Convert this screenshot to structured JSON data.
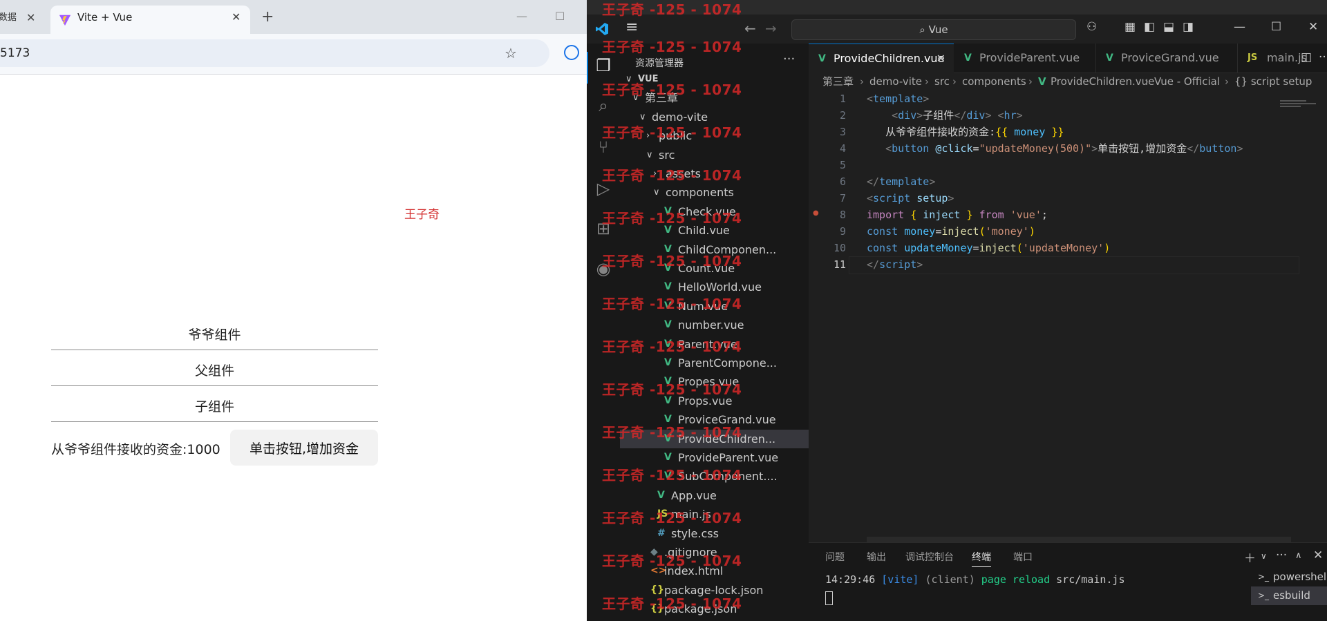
{
  "browser": {
    "prev_tab_title": "数据",
    "tab_title": "Vite + Vue",
    "url": "5173",
    "page": {
      "name": "王子奇",
      "grandparent_label": "爷爷组件",
      "parent_label": "父组件",
      "child_label": "子组件",
      "money_label": "从爷爷组件接收的资金:",
      "money_value": "1000",
      "add_button_label": "单击按钮,增加资金"
    }
  },
  "vscode": {
    "search_text": "Vue",
    "explorer_title": "资源管理器",
    "tree": [
      {
        "label": "VUE",
        "depth": 0,
        "type": "folder"
      },
      {
        "label": "第三章",
        "depth": 1,
        "type": "folder"
      },
      {
        "label": "demo-vite",
        "depth": 2,
        "type": "folder"
      },
      {
        "label": "public",
        "depth": 3,
        "type": "folder-closed"
      },
      {
        "label": "src",
        "depth": 3,
        "type": "folder"
      },
      {
        "label": "assets",
        "depth": 4,
        "type": "folder-closed"
      },
      {
        "label": "components",
        "depth": 4,
        "type": "folder"
      },
      {
        "label": "Check.vue",
        "depth": 5,
        "type": "vue"
      },
      {
        "label": "Child.vue",
        "depth": 5,
        "type": "vue"
      },
      {
        "label": "ChildComponen...",
        "depth": 5,
        "type": "vue"
      },
      {
        "label": "Count.vue",
        "depth": 5,
        "type": "vue"
      },
      {
        "label": "HelloWorld.vue",
        "depth": 5,
        "type": "vue"
      },
      {
        "label": "Num.vue",
        "depth": 5,
        "type": "vue"
      },
      {
        "label": "number.vue",
        "depth": 5,
        "type": "vue"
      },
      {
        "label": "Parent.vue",
        "depth": 5,
        "type": "vue"
      },
      {
        "label": "ParentCompone...",
        "depth": 5,
        "type": "vue"
      },
      {
        "label": "Propes.vue",
        "depth": 5,
        "type": "vue"
      },
      {
        "label": "Props.vue",
        "depth": 5,
        "type": "vue"
      },
      {
        "label": "ProviceGrand.vue",
        "depth": 5,
        "type": "vue"
      },
      {
        "label": "ProvideChildren...",
        "depth": 5,
        "type": "vue",
        "selected": true
      },
      {
        "label": "ProvideParent.vue",
        "depth": 5,
        "type": "vue"
      },
      {
        "label": "SubComponent....",
        "depth": 5,
        "type": "vue"
      },
      {
        "label": "App.vue",
        "depth": 4,
        "type": "vue"
      },
      {
        "label": "main.js",
        "depth": 4,
        "type": "js"
      },
      {
        "label": "style.css",
        "depth": 4,
        "type": "css"
      },
      {
        "label": ".gitignore",
        "depth": 3,
        "type": "git"
      },
      {
        "label": "index.html",
        "depth": 3,
        "type": "html"
      },
      {
        "label": "package-lock.json",
        "depth": 3,
        "type": "json"
      },
      {
        "label": "package.json",
        "depth": 3,
        "type": "json"
      }
    ],
    "tabs": [
      {
        "label": "ProvideChildren.vue",
        "icon": "vue",
        "active": true
      },
      {
        "label": "ProvideParent.vue",
        "icon": "vue"
      },
      {
        "label": "ProviceGrand.vue",
        "icon": "vue"
      },
      {
        "label": "main.js",
        "icon": "js"
      }
    ],
    "breadcrumb": [
      "第三章",
      "demo-vite",
      "src",
      "components",
      "ProvideChildren.vue",
      "Vue - Official",
      "{} script setup"
    ],
    "code": [
      [
        [
          "tk-ang",
          "<"
        ],
        [
          "tk-tag",
          "template"
        ],
        [
          "tk-ang",
          ">"
        ]
      ],
      [
        [
          "tk-text",
          "    "
        ],
        [
          "tk-ang",
          "<"
        ],
        [
          "tk-tag",
          "div"
        ],
        [
          "tk-ang",
          ">"
        ],
        [
          "tk-text",
          "子组件"
        ],
        [
          "tk-ang",
          "</"
        ],
        [
          "tk-tag",
          "div"
        ],
        [
          "tk-ang",
          "> <"
        ],
        [
          "tk-tag",
          "hr"
        ],
        [
          "tk-ang",
          ">"
        ]
      ],
      [
        [
          "tk-text",
          "   从爷爷组件接收的资金:"
        ],
        [
          "tk-brace",
          "{{"
        ],
        [
          "tk-var",
          " money "
        ],
        [
          "tk-brace",
          "}}"
        ]
      ],
      [
        [
          "tk-text",
          "   "
        ],
        [
          "tk-ang",
          "<"
        ],
        [
          "tk-tag",
          "button"
        ],
        [
          "tk-text",
          " "
        ],
        [
          "tk-attr",
          "@click"
        ],
        [
          "tk-text",
          "="
        ],
        [
          "tk-str",
          "\"updateMoney(500)\""
        ],
        [
          "tk-ang",
          ">"
        ],
        [
          "tk-text",
          "单击按钮,增加资金"
        ],
        [
          "tk-ang",
          "</"
        ],
        [
          "tk-tag",
          "button"
        ],
        [
          "tk-ang",
          ">"
        ]
      ],
      [],
      [
        [
          "tk-ang",
          "</"
        ],
        [
          "tk-tag",
          "template"
        ],
        [
          "tk-ang",
          ">"
        ]
      ],
      [
        [
          "tk-ang",
          "<"
        ],
        [
          "tk-tag",
          "script"
        ],
        [
          "tk-text",
          " "
        ],
        [
          "tk-attr",
          "setup"
        ],
        [
          "tk-ang",
          ">"
        ]
      ],
      [
        [
          "tk-kw",
          "import"
        ],
        [
          "tk-text",
          " "
        ],
        [
          "tk-brace",
          "{"
        ],
        [
          "tk-text",
          " "
        ],
        [
          "tk-attr",
          "inject"
        ],
        [
          "tk-text",
          " "
        ],
        [
          "tk-brace",
          "}"
        ],
        [
          "tk-text",
          " "
        ],
        [
          "tk-kw",
          "from"
        ],
        [
          "tk-text",
          " "
        ],
        [
          "tk-str",
          "'vue'"
        ],
        [
          "tk-text",
          ";"
        ]
      ],
      [
        [
          "tk-key",
          "const"
        ],
        [
          "tk-text",
          " "
        ],
        [
          "tk-var",
          "money"
        ],
        [
          "tk-text",
          "="
        ],
        [
          "tk-fn",
          "inject"
        ],
        [
          "tk-brace",
          "("
        ],
        [
          "tk-str",
          "'money'"
        ],
        [
          "tk-brace",
          ")"
        ]
      ],
      [
        [
          "tk-key",
          "const"
        ],
        [
          "tk-text",
          " "
        ],
        [
          "tk-var",
          "updateMoney"
        ],
        [
          "tk-text",
          "="
        ],
        [
          "tk-fn",
          "inject"
        ],
        [
          "tk-brace",
          "("
        ],
        [
          "tk-str",
          "'updateMoney'"
        ],
        [
          "tk-brace",
          ")"
        ]
      ],
      [
        [
          "tk-ang",
          "</"
        ],
        [
          "tk-tag",
          "script"
        ],
        [
          "tk-ang",
          ">"
        ]
      ]
    ],
    "panel_tabs": [
      "问题",
      "输出",
      "调试控制台",
      "终端",
      "端口"
    ],
    "terminal_line": [
      [
        "#cccccc",
        "14:29:46 "
      ],
      [
        "#3b8eea",
        "[vite]"
      ],
      [
        "#9d9d9d",
        " (client) "
      ],
      [
        "#23d18b",
        "page reload "
      ],
      [
        "#cccccc",
        "src/main.js"
      ]
    ],
    "terminals": [
      "powershell",
      "esbuild"
    ]
  },
  "watermark": "王子奇 -125 - 1074"
}
